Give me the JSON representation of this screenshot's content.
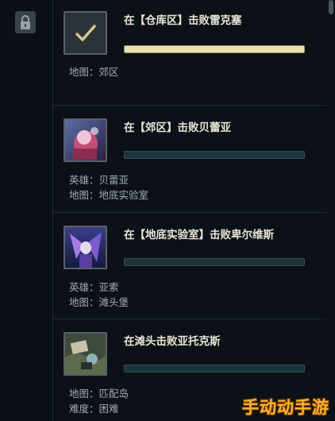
{
  "theme": {
    "background": "#0b1116",
    "text": "#e8e3d6",
    "muted": "#a4acb0",
    "bar_track": "#1a363b",
    "bar_fill": "#e9dfb0"
  },
  "rail": {
    "icon": "lock-icon"
  },
  "missions": [
    {
      "title": "在【仓库区】击败雷克塞",
      "thumb_icon": "check-mark-icon",
      "progress": 1.0,
      "meta": [
        {
          "label": "地图：",
          "value": "郊区"
        }
      ]
    },
    {
      "title": "在【郊区】击败贝蕾亚",
      "thumb_icon": "champion-portrait-briar",
      "progress": 0.0,
      "meta": [
        {
          "label": "英雄：",
          "value": "贝蕾亚"
        },
        {
          "label": "地图：",
          "value": "地底实验室"
        }
      ]
    },
    {
      "title": "在【地底实验室】击败卑尔维斯",
      "thumb_icon": "champion-portrait-belveth",
      "progress": 0.0,
      "meta": [
        {
          "label": "英雄：",
          "value": "亚索"
        },
        {
          "label": "地图：",
          "value": "滩头堡"
        }
      ]
    },
    {
      "title": "在滩头击败亚托克斯",
      "thumb_icon": "map-thumbnail",
      "progress": 0.0,
      "meta": [
        {
          "label": "地图：",
          "value": "匹配岛"
        },
        {
          "label": "难度：",
          "value": "困难"
        }
      ]
    }
  ],
  "watermark": "手动动手游"
}
